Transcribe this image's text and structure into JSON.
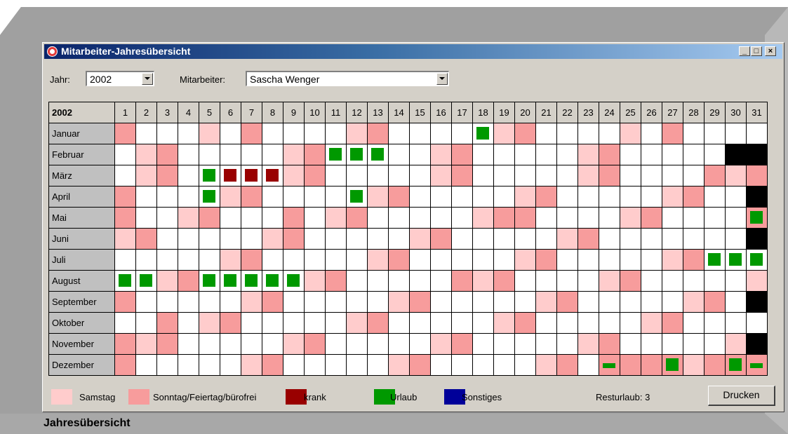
{
  "window": {
    "title": "Mitarbeiter-Jahresübersicht",
    "controls": [
      "_",
      "□",
      "×"
    ]
  },
  "filters": {
    "year_label": "Jahr:",
    "year_value": "2002",
    "employee_label": "Mitarbeiter:",
    "employee_value": "Sascha Wenger"
  },
  "calendar": {
    "year": "2002",
    "days": [
      "1",
      "2",
      "3",
      "4",
      "5",
      "6",
      "7",
      "8",
      "9",
      "10",
      "11",
      "12",
      "13",
      "14",
      "15",
      "16",
      "17",
      "18",
      "19",
      "20",
      "21",
      "22",
      "23",
      "24",
      "25",
      "26",
      "27",
      "28",
      "29",
      "30",
      "31"
    ],
    "colors": {
      "workday": "#ffffff",
      "saturday": "#ffcccc",
      "sunday_holiday": "#f79c9c",
      "invalid": "#000000",
      "krank": "#990000",
      "urlaub": "#009900",
      "sonstiges": "#000099"
    },
    "months": [
      {
        "name": "Januar",
        "cells": "SoWWWSaSoWWWWWSaSoWWWWWSaSoWWWWWSaSoWWW",
        "codes": "OWWWASOWWWWAOWWWWUAOWWWWASOWWWWWW",
        "marks": [
          {
            "day": 18,
            "type": "urlaub"
          }
        ]
      },
      {
        "name": "Februar",
        "codes": "WAOWWWWWAOWWWWWAOWWWWWAOWWWWWXXX",
        "marks": [
          {
            "day": 11,
            "type": "urlaub"
          },
          {
            "day": 12,
            "type": "urlaub"
          },
          {
            "day": 13,
            "type": "urlaub"
          }
        ]
      },
      {
        "name": "März",
        "codes": "WAOWWWWWAOWWWWWAOWWWWWAOWWWWOAO",
        "marks": [
          {
            "day": 5,
            "type": "urlaub"
          },
          {
            "day": 6,
            "type": "krank"
          },
          {
            "day": 7,
            "type": "krank"
          },
          {
            "day": 8,
            "type": "krank"
          }
        ]
      },
      {
        "name": "April",
        "codes": "OWWWWAOWWWWWAOWWWWWAOWWWWWAOWWX",
        "marks": [
          {
            "day": 5,
            "type": "urlaub"
          },
          {
            "day": 12,
            "type": "urlaub"
          }
        ]
      },
      {
        "name": "Mai",
        "codes": "OWWAOWWWOWAOWWWWWAOOWWWWAOWWWWOW",
        "marks": [
          {
            "day": 31,
            "type": "urlaub"
          }
        ]
      },
      {
        "name": "Juni",
        "codes": "AOWWWWWAOWWWWWAOWWWWWAOWWWWWWWX",
        "marks": []
      },
      {
        "name": "Juli",
        "codes": "WWWWWAOWWWWWAOWWWWWAOWWWWWAOWWW",
        "marks": [
          {
            "day": 29,
            "type": "urlaub"
          },
          {
            "day": 30,
            "type": "urlaub"
          },
          {
            "day": 31,
            "type": "urlaub"
          }
        ]
      },
      {
        "name": "August",
        "codes": "WWAOWWWWWAOWWWWWOAOWWWWAOWWWWWA",
        "marks": [
          {
            "day": 1,
            "type": "urlaub"
          },
          {
            "day": 2,
            "type": "urlaub"
          },
          {
            "day": 5,
            "type": "urlaub"
          },
          {
            "day": 6,
            "type": "urlaub"
          },
          {
            "day": 7,
            "type": "urlaub"
          },
          {
            "day": 8,
            "type": "urlaub"
          },
          {
            "day": 9,
            "type": "urlaub"
          }
        ]
      },
      {
        "name": "September",
        "codes": "OWWWWWAOWWWWWAOWWWWWAOWWWWWAOWX",
        "marks": []
      },
      {
        "name": "Oktober",
        "codes": "WWOWAOWWWWWAOWWWWWAOWWWWWAOWWWW",
        "marks": []
      },
      {
        "name": "November",
        "codes": "OAOWWWWWAOWWWWWAOWWWWWAOWWWWWAX",
        "marks": []
      },
      {
        "name": "Dezember",
        "codes": "OWWWWWAOWWWWWAOWWWWWAOWOOOOAOOOO",
        "marks": [
          {
            "day": 24,
            "type": "urlaub-half"
          },
          {
            "day": 27,
            "type": "urlaub"
          },
          {
            "day": 30,
            "type": "urlaub"
          },
          {
            "day": 31,
            "type": "urlaub-half"
          }
        ]
      }
    ]
  },
  "legend": {
    "items": [
      {
        "label": "Samstag",
        "color": "#ffcccc"
      },
      {
        "label": "Sonntag/Feiertag/bürofrei",
        "color": "#f79c9c"
      },
      {
        "label": "krank",
        "color": "#990000"
      },
      {
        "label": "Urlaub",
        "color": "#009900"
      },
      {
        "label": "Sonstiges",
        "color": "#000099"
      }
    ],
    "resturlaub": "Resturlaub: 3"
  },
  "actions": {
    "print_label": "Drucken"
  },
  "caption": "Jahresübersicht"
}
